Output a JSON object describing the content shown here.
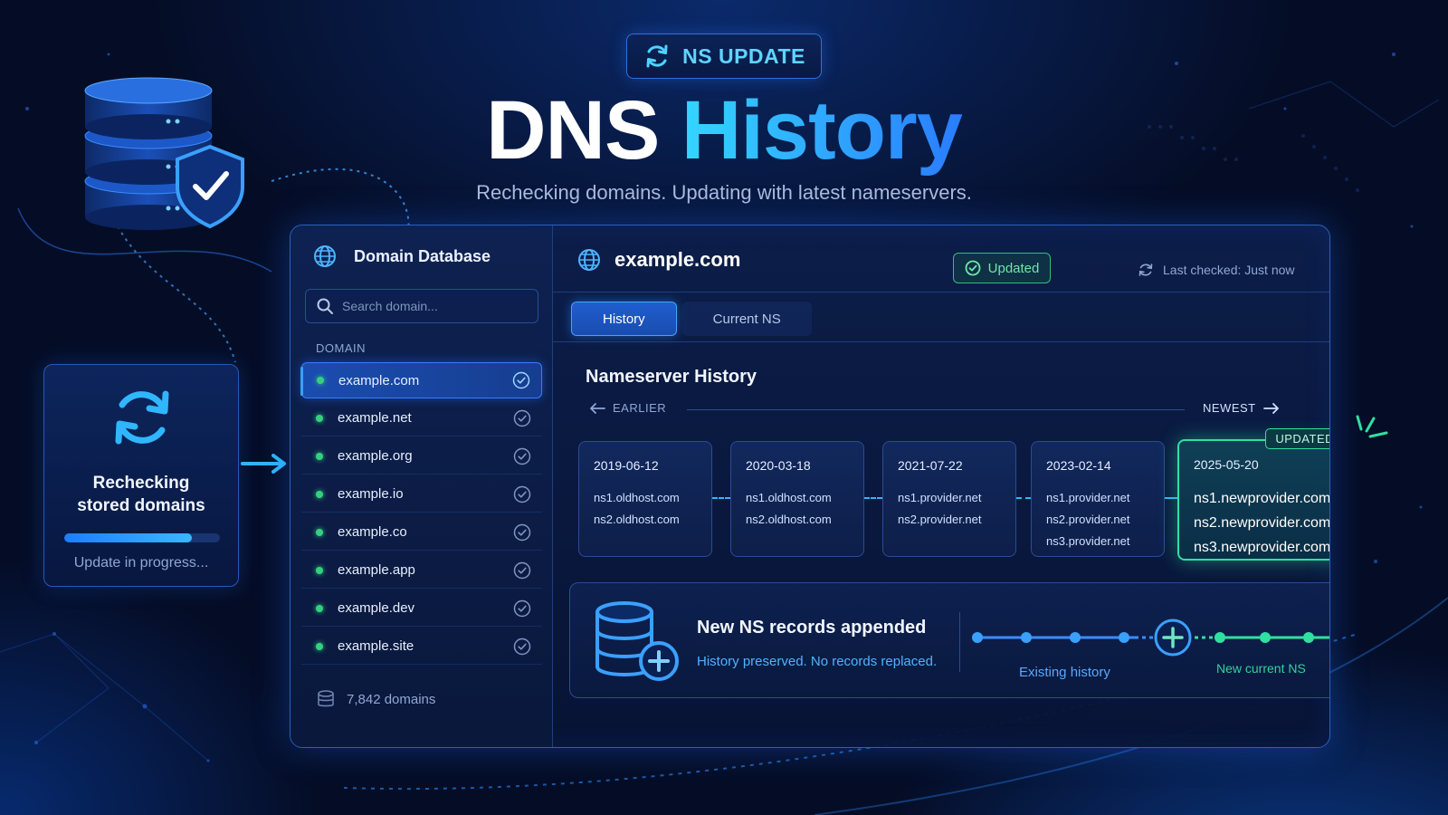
{
  "header": {
    "badge_label": "NS UPDATE",
    "title_part1": "DNS",
    "title_part2": "History",
    "subtitle": "Rechecking domains. Updating with latest nameservers."
  },
  "recheck_card": {
    "title_line1": "Rechecking",
    "title_line2": "stored domains",
    "progress": 0.82,
    "status": "Update in progress..."
  },
  "sidebar": {
    "title": "Domain Database",
    "search_placeholder": "Search domain...",
    "column_label": "DOMAIN",
    "domains": [
      {
        "name": "example.com",
        "active": true
      },
      {
        "name": "example.net"
      },
      {
        "name": "example.org"
      },
      {
        "name": "example.io"
      },
      {
        "name": "example.co"
      },
      {
        "name": "example.app"
      },
      {
        "name": "example.dev"
      },
      {
        "name": "example.site"
      }
    ],
    "footer_count": "7,842 domains"
  },
  "content": {
    "domain": "example.com",
    "status_badge": "Updated",
    "last_checked": "Last checked: Just now",
    "tabs": [
      {
        "label": "History",
        "active": true
      },
      {
        "label": "Current NS",
        "active": false
      }
    ],
    "section_title": "Nameserver History",
    "earlier_label": "EARLIER",
    "newest_label": "NEWEST",
    "history": [
      {
        "date": "2019-06-12",
        "ns": [
          "ns1.oldhost.com",
          "ns2.oldhost.com"
        ]
      },
      {
        "date": "2020-03-18",
        "ns": [
          "ns1.oldhost.com",
          "ns2.oldhost.com"
        ]
      },
      {
        "date": "2021-07-22",
        "ns": [
          "ns1.provider.net",
          "ns2.provider.net"
        ]
      },
      {
        "date": "2023-02-14",
        "ns": [
          "ns1.provider.net",
          "ns2.provider.net",
          "ns3.provider.net"
        ]
      },
      {
        "date": "2025-05-20",
        "ns": [
          "ns1.newprovider.com",
          "ns2.newprovider.com",
          "ns3.newprovider.com"
        ],
        "tag": "UPDATED"
      }
    ],
    "append_panel": {
      "title": "New NS records appended",
      "subtitle": "History preserved. No records replaced.",
      "existing_label": "Existing history",
      "new_label": "New current NS"
    }
  },
  "colors": {
    "accent_blue": "#2a7cff",
    "accent_cyan": "#34d6ff",
    "success_green": "#2fe0a0",
    "background": "#050d26"
  }
}
